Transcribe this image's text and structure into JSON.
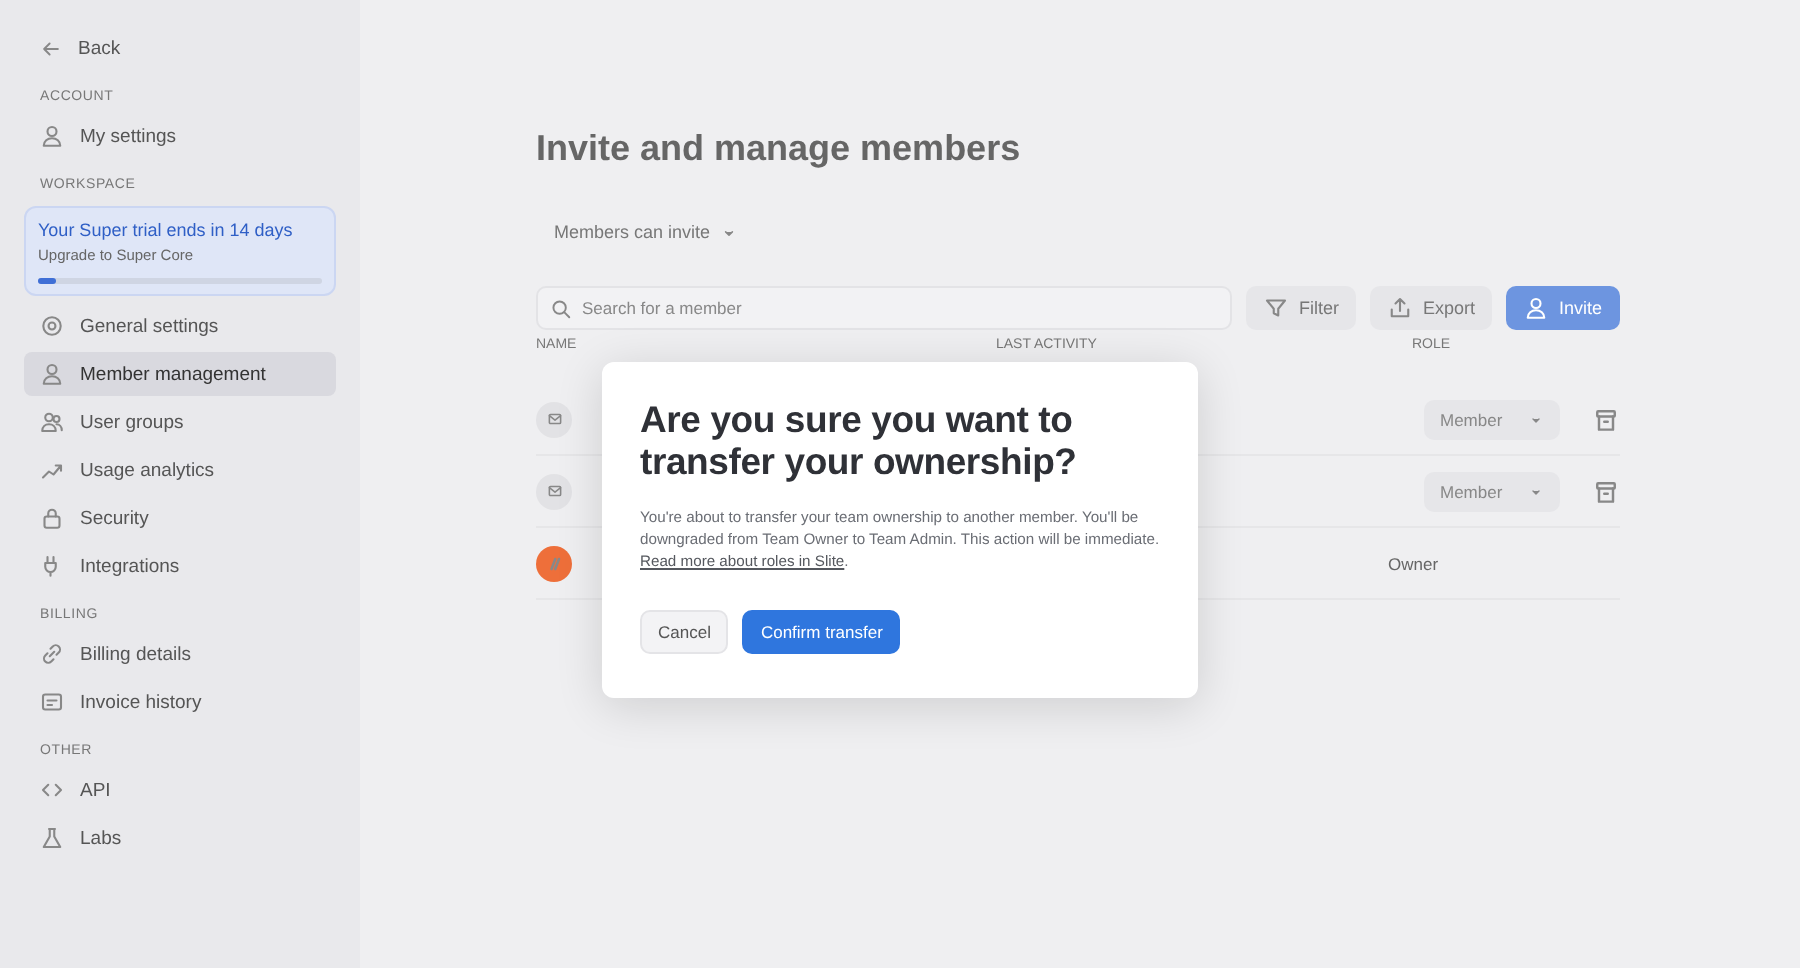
{
  "sidebar": {
    "back": "Back",
    "sections": [
      {
        "heading": "ACCOUNT",
        "items": [
          {
            "label": "My settings",
            "selected": false
          }
        ]
      },
      {
        "heading": "WORKSPACE",
        "trial": {
          "title": "Your Super trial ends in 14 days",
          "subtitle": "Upgrade to Super Core",
          "level": 0.06
        },
        "items": [
          {
            "label": "General settings",
            "selected": false
          },
          {
            "label": "Member management",
            "selected": true
          },
          {
            "label": "User groups",
            "selected": false
          },
          {
            "label": "Usage analytics",
            "selected": false
          },
          {
            "label": "Security",
            "selected": false
          },
          {
            "label": "Integrations",
            "selected": false
          }
        ]
      },
      {
        "heading": "BILLING",
        "items": [
          {
            "label": "Billing details",
            "selected": false
          },
          {
            "label": "Invoice history",
            "selected": false
          }
        ]
      },
      {
        "heading": "OTHER",
        "items": [
          {
            "label": "API",
            "selected": false
          },
          {
            "label": "Labs",
            "selected": false
          }
        ]
      }
    ]
  },
  "main": {
    "title": "Invite and manage members",
    "invite_setting": "Members can invite",
    "search": {
      "placeholder": "Search for a member"
    },
    "buttons": [
      {
        "label": "Filter",
        "kind": "filter"
      },
      {
        "label": "Export",
        "kind": "export"
      },
      {
        "label": "Invite",
        "kind": "invite"
      }
    ],
    "table": {
      "columns": [
        "NAME",
        "LAST ACTIVITY",
        "ROLE"
      ],
      "rows": [
        {
          "kind": "pending",
          "role": "Member"
        },
        {
          "kind": "pending",
          "role": "Member"
        },
        {
          "kind": "owner",
          "role": "Owner"
        }
      ]
    }
  },
  "dialog": {
    "title": "Are you sure you want to transfer your ownership?",
    "body": "You're about to transfer your team ownership to another member. You'll be downgraded from Team Owner to Team Admin. This action will be immediate.",
    "link": "Read more about roles in Slite",
    "link_suffix": ".",
    "buttons": [
      {
        "label": "Cancel",
        "kind": "secondary"
      },
      {
        "label": "Confirm transfer",
        "kind": "primary"
      }
    ]
  }
}
